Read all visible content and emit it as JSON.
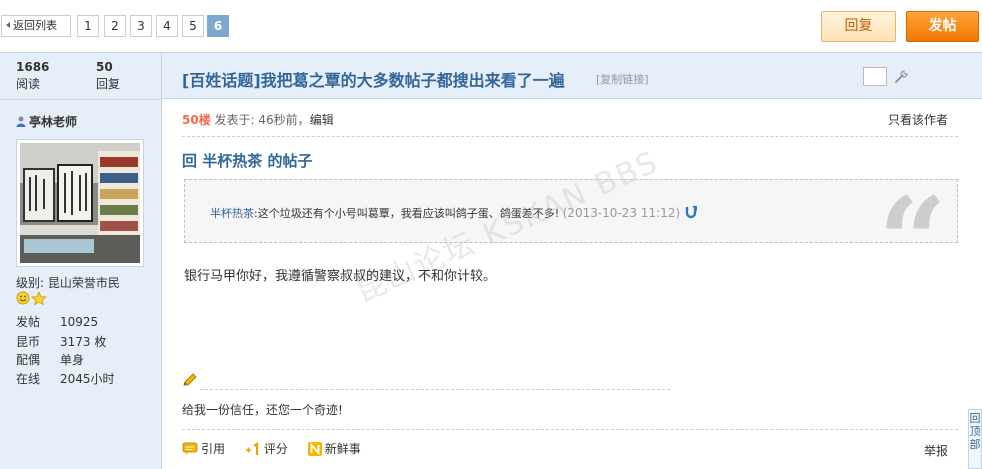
{
  "pager": {
    "back_label": "返回列表",
    "pages": [
      "1",
      "2",
      "3",
      "4",
      "5",
      "6"
    ],
    "current_page": "6"
  },
  "toolbar": {
    "reply_label": "回复",
    "post_label": "发帖"
  },
  "thread": {
    "views": "1686",
    "views_label": "阅读",
    "replies": "50",
    "replies_label": "回复",
    "title": "[百姓话题]我把葛之覃的大多数帖子都搜出来看了一遍",
    "copy_link": "[复制链接]"
  },
  "user": {
    "name": "亭林老师",
    "level": "级别: 昆山荣誉市民",
    "stats": [
      {
        "k": "发帖",
        "v": "10925"
      },
      {
        "k": "昆币",
        "v": "3173 枚"
      },
      {
        "k": "配偶",
        "v": "单身"
      },
      {
        "k": "在线",
        "v": "2045小时"
      }
    ]
  },
  "post": {
    "floor": "50楼",
    "posted_at": "发表于: 46秒前",
    "sep": "，",
    "edit_label": "编辑",
    "only_author": "只看该作者",
    "reply_heading": "回  半杯热茶  的帖子",
    "quote": {
      "name": "半杯热茶",
      "text": ":这个垃圾还有个小号叫葛覃，我看应该叫鸽子蛋、鸽蛋差不多!",
      "time": "(2013-10-23 11:12)"
    },
    "body": "银行马甲你好，我遵循警察叔叔的建议，不和你计较。",
    "watermark": "昆山论坛 KSKAN BBS",
    "signature": "给我一份信任，还您一个奇迹!",
    "actions": {
      "quote": "引用",
      "rate": "评分",
      "news": "新鲜事",
      "report": "举报"
    }
  },
  "back_to_top": "回顶部",
  "colors": {
    "accent": "#336699",
    "floor": "#f26c4f",
    "post_button": "#f07800",
    "sidebar_bg": "#e5eef9"
  }
}
